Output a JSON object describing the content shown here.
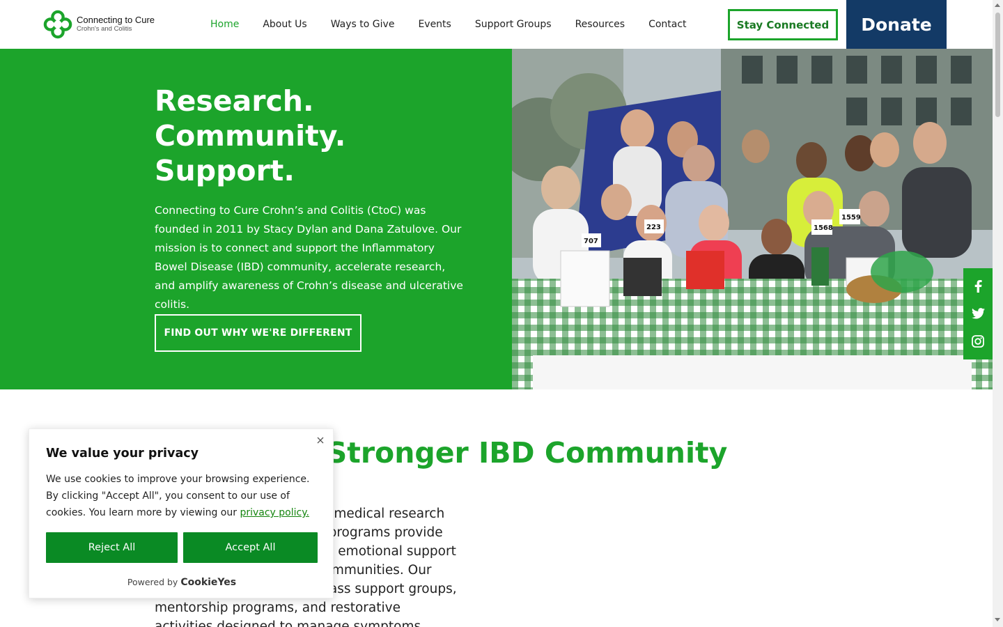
{
  "colors": {
    "brand_green": "#1ca42b",
    "navy": "#133a66",
    "cookie_green": "#0a8a24"
  },
  "logo": {
    "title": "Connecting to Cure",
    "subtitle": "Crohn's and Colitis",
    "icon": "clover-logo-icon"
  },
  "nav": {
    "items": [
      {
        "label": "Home",
        "active": true
      },
      {
        "label": "About Us"
      },
      {
        "label": "Ways to Give"
      },
      {
        "label": "Events"
      },
      {
        "label": "Support Groups"
      },
      {
        "label": "Resources"
      },
      {
        "label": "Contact"
      }
    ]
  },
  "header": {
    "stay_connected": "Stay Connected",
    "donate": "Donate"
  },
  "hero": {
    "title_lines": [
      "Research.",
      "Community.",
      "Support."
    ],
    "description": "Connecting to Cure Crohn’s and Colitis (CtoC) was founded in 2011 by Stacy Dylan and Dana Zatulove. Our mission is to connect and support the Inflammatory Bowel Disease (IBD) community, accelerate research, and amplify awareness of Crohn’s disease and ulcerative colitis.",
    "button": "FIND OUT WHY WE'RE DIFFERENT",
    "photo_bibs": [
      "1568",
      "1559",
      "707",
      "223"
    ]
  },
  "social": {
    "icons": [
      "facebook-icon",
      "twitter-icon",
      "instagram-icon"
    ]
  },
  "section": {
    "title": "Building a Stronger IBD Community",
    "body": "We’re dedicated to funding medical research and our community-based programs provide informational, physical, and emotional support to those in IBD and their communities. Our ongoing initiatives encompass support groups, mentorship programs, and restorative activities designed to manage symptoms, optimize"
  },
  "cookie": {
    "title": "We value your privacy",
    "text": "We use cookies to improve your browsing experience. By clicking \"Accept All\", you consent to our use of cookies. You learn more by viewing our",
    "link": "privacy policy.",
    "reject": "Reject All",
    "accept": "Accept All",
    "powered_by": "Powered by",
    "brand": "CookieYes"
  }
}
